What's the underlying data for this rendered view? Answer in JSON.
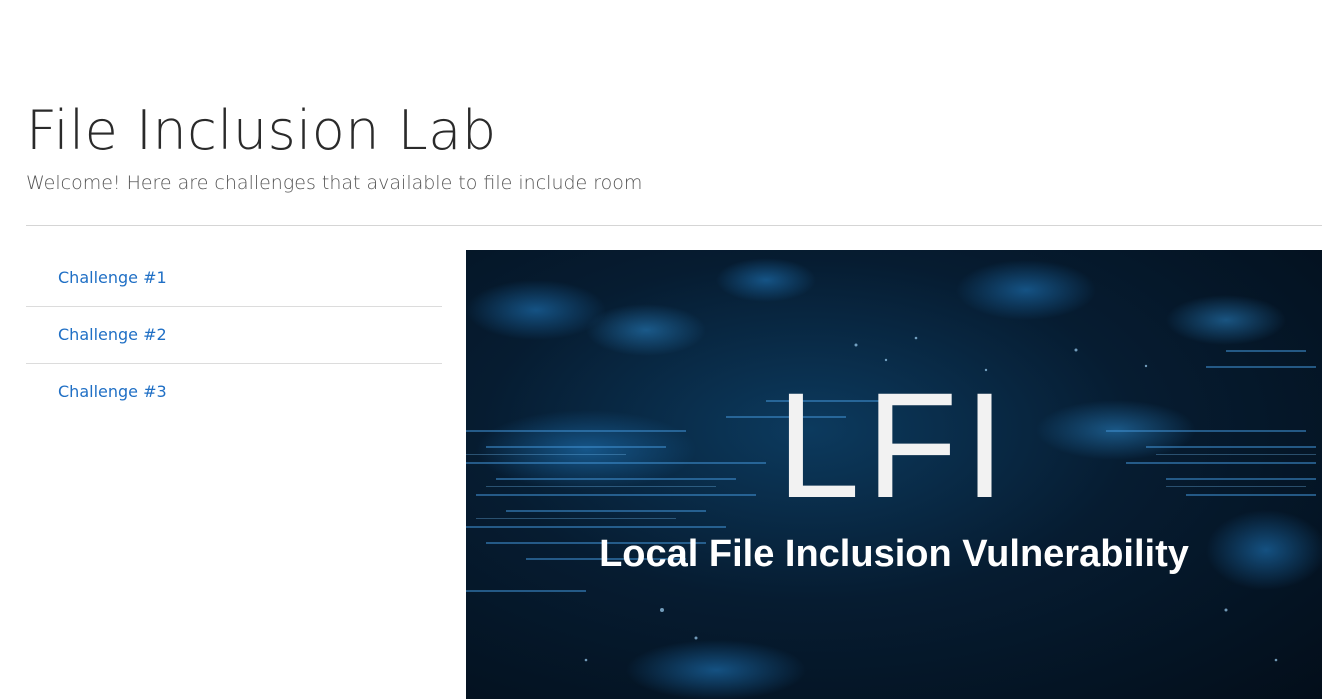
{
  "header": {
    "title": "File Inclusion Lab",
    "subtitle": "Welcome! Here are challenges that available to file include room"
  },
  "sidebar": {
    "items": [
      {
        "label": "Challenge #1"
      },
      {
        "label": "Challenge #2"
      },
      {
        "label": "Challenge #3"
      }
    ]
  },
  "hero": {
    "headline": "LFI",
    "caption": "Local File Inclusion Vulnerability"
  },
  "colors": {
    "link": "#1f6fc5",
    "title": "#2a2a2a",
    "hero_background": "#061c31"
  }
}
